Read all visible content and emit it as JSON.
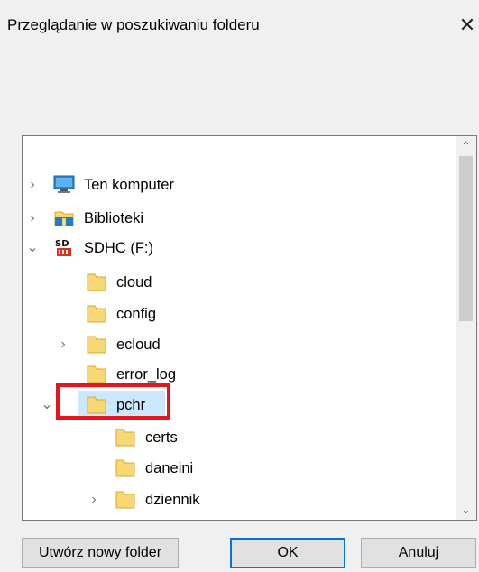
{
  "dialog": {
    "title": "Przeglądanie w poszukiwaniu folderu",
    "close_glyph": "✕"
  },
  "tree": {
    "items": [
      {
        "label": "Ten komputer",
        "icon": "computer-icon",
        "expander": "›"
      },
      {
        "label": "Biblioteki",
        "icon": "libraries-icon",
        "expander": "›"
      },
      {
        "label": "SDHC (F:)",
        "icon": "sd-card-icon",
        "expander": "⌄"
      },
      {
        "label": "cloud",
        "icon": "folder-icon"
      },
      {
        "label": "config",
        "icon": "folder-icon"
      },
      {
        "label": "ecloud",
        "icon": "folder-icon",
        "expander": "›"
      },
      {
        "label": "error_log",
        "icon": "folder-icon"
      },
      {
        "label": "pchr",
        "icon": "folder-icon",
        "expander": "⌄",
        "selected": true
      },
      {
        "label": "certs",
        "icon": "folder-icon"
      },
      {
        "label": "daneini",
        "icon": "folder-icon"
      },
      {
        "label": "dziennik",
        "icon": "folder-icon",
        "expander": "›"
      }
    ]
  },
  "scrollbar": {
    "up": "⌃",
    "down": "⌄"
  },
  "buttons": {
    "new_folder": "Utwórz nowy folder",
    "ok": "OK",
    "cancel": "Anuluj"
  },
  "colors": {
    "selection": "#cce8ff",
    "highlight": "#e8151f",
    "folder": "#f8d775"
  }
}
